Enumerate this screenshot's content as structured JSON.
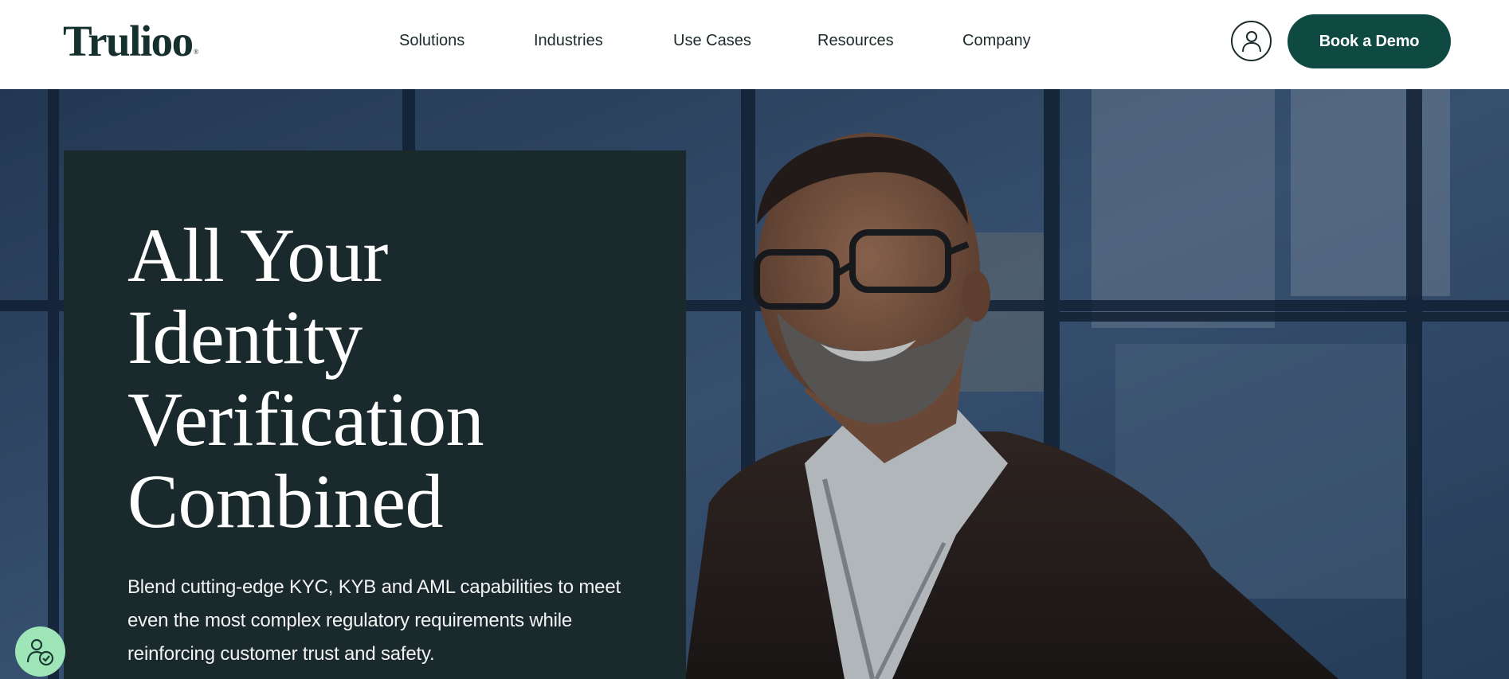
{
  "brand": {
    "name": "Trulioo",
    "registered_mark": "®"
  },
  "nav": {
    "items": [
      {
        "label": "Solutions"
      },
      {
        "label": "Industries"
      },
      {
        "label": "Use Cases"
      },
      {
        "label": "Resources"
      },
      {
        "label": "Company"
      }
    ]
  },
  "header": {
    "account_icon": "user-circle-icon",
    "cta_label": "Book a Demo"
  },
  "hero": {
    "headline_lines": [
      "All Your",
      "Identity",
      "Verification",
      "Combined"
    ],
    "subtext": "Blend cutting-edge KYC, KYB and AML capabilities to meet even the most complex regulatory requirements while reinforcing customer trust and safety."
  },
  "accessibility_widget": {
    "icon": "user-shield-icon"
  },
  "colors": {
    "brand_dark": "#16302e",
    "cta_green": "#0f4a42",
    "panel_dark": "#19292c",
    "accessibility_mint": "#9ee6b8"
  }
}
